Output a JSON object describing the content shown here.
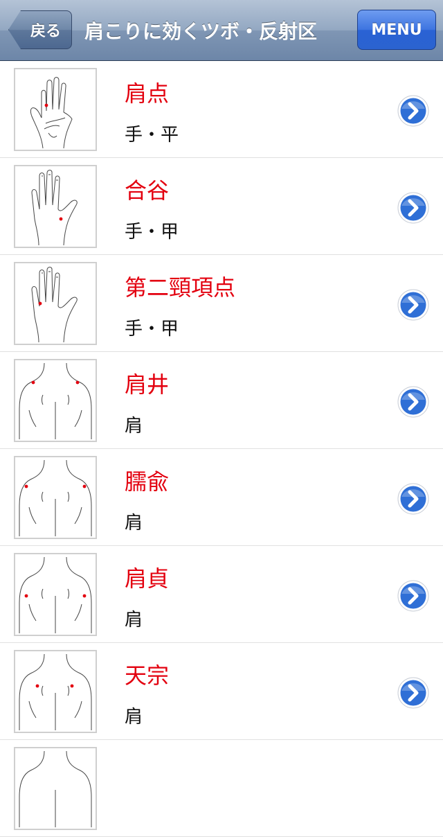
{
  "navbar": {
    "back_label": "戻る",
    "title": "肩こりに効くツボ・反射区",
    "menu_label": "MENU"
  },
  "colors": {
    "title_red": "#e3000f",
    "disclosure_blue": "#2f6fd6"
  },
  "items": [
    {
      "name": "肩点",
      "location": "手・平",
      "illustration": "palm-illustration"
    },
    {
      "name": "合谷",
      "location": "手・甲",
      "illustration": "hand-back-illustration"
    },
    {
      "name": "第二頸項点",
      "location": "手・甲",
      "illustration": "hand-back-illustration"
    },
    {
      "name": "肩井",
      "location": "肩",
      "illustration": "upper-back-illustration"
    },
    {
      "name": "臑兪",
      "location": "肩",
      "illustration": "upper-back-illustration"
    },
    {
      "name": "肩貞",
      "location": "肩",
      "illustration": "upper-back-illustration"
    },
    {
      "name": "天宗",
      "location": "肩",
      "illustration": "upper-back-illustration"
    },
    {
      "name": "",
      "location": "",
      "illustration": "upper-back-illustration"
    }
  ]
}
